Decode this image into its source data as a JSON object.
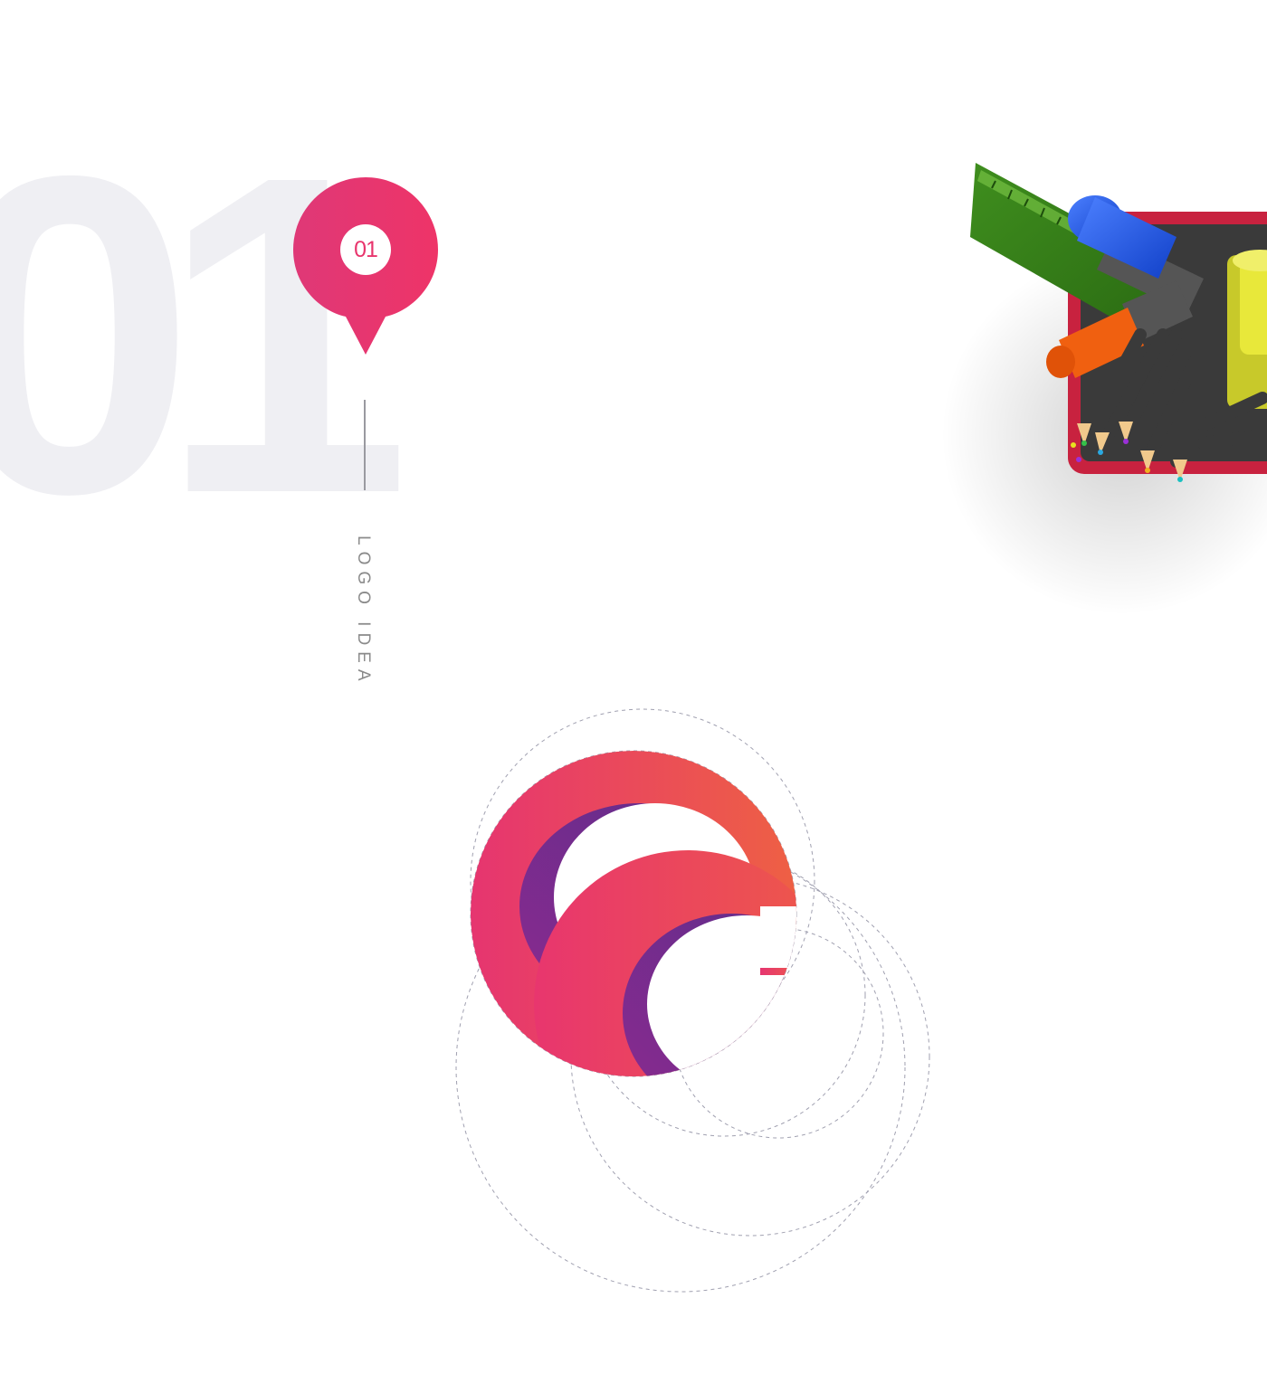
{
  "section": {
    "number": "01",
    "badge_number": "01",
    "label": "LOGO IDEA"
  },
  "colors": {
    "accent": "#e8356d",
    "accent_light": "#ec3d6e",
    "gradient_pink": "#e63570",
    "gradient_orange": "#ee6044",
    "gradient_purple": "#8a2b8f",
    "gradient_deep_purple": "#5e2c8b",
    "number_watermark": "#efeff3",
    "guide_lines": "#a0a0b0",
    "label_text": "#8a8a8a"
  },
  "illustration": {
    "name": "pencil-cup-icon"
  },
  "logo": {
    "name": "gradient-c-logo-icon"
  }
}
